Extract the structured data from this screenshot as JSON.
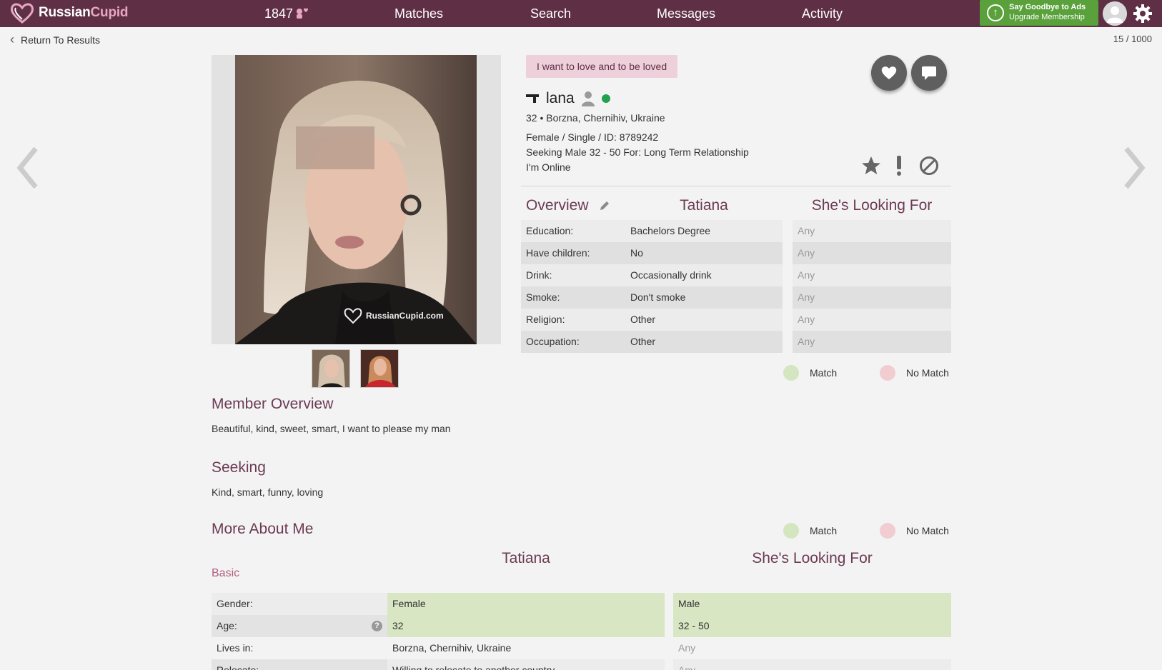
{
  "nav": {
    "logo_part1": "Russian",
    "logo_part2": "Cupid",
    "likes_count": "1847",
    "matches": "Matches",
    "search": "Search",
    "messages": "Messages",
    "activity": "Activity",
    "upgrade_line1": "Say Goodbye to Ads",
    "upgrade_line2": "Upgrade Membership"
  },
  "page": {
    "back_label": "Return To Results",
    "counter": "15 / 1000"
  },
  "profile": {
    "tagline": "I want to love and to be loved",
    "name": "lana",
    "location_line": "32 • Borzna, Chernihiv, Ukraine",
    "details_line": "Female / Single / ID: 8789242",
    "seeking_line": "Seeking Male 32 - 50 For: Long Term Relationship",
    "online_line": "I'm Online"
  },
  "overview": {
    "title": "Overview",
    "col_her": "Tatiana",
    "col_looking": "She's Looking For",
    "rows": [
      {
        "label": "Education:",
        "value": "Bachelors Degree",
        "looking": "Any"
      },
      {
        "label": "Have children:",
        "value": "No",
        "looking": "Any"
      },
      {
        "label": "Drink:",
        "value": "Occasionally drink",
        "looking": "Any"
      },
      {
        "label": "Smoke:",
        "value": "Don't smoke",
        "looking": "Any"
      },
      {
        "label": "Religion:",
        "value": "Other",
        "looking": "Any"
      },
      {
        "label": "Occupation:",
        "value": "Other",
        "looking": "Any"
      }
    ]
  },
  "legend": {
    "match": "Match",
    "no_match": "No Match"
  },
  "member_overview": {
    "title": "Member Overview",
    "text": "Beautiful, kind, sweet, smart, I want to please my man"
  },
  "seeking": {
    "title": "Seeking",
    "text": "Kind, smart, funny, loving"
  },
  "more_about": {
    "title": "More About Me",
    "col_her": "Tatiana",
    "col_looking": "She's Looking For",
    "basic": "Basic",
    "rows": [
      {
        "label": "Gender:",
        "value": "Female",
        "looking": "Male"
      },
      {
        "label": "Age:",
        "value": "32",
        "looking": "32 - 50"
      },
      {
        "label": "Lives in:",
        "value": "Borzna, Chernihiv, Ukraine",
        "looking": "Any"
      },
      {
        "label": "Relocate:",
        "value": "Willing to relocate to another country",
        "looking": "Any"
      }
    ]
  },
  "colors": {
    "nav_bg": "#5f2f45",
    "accent": "#6b3b52",
    "upgrade_green": "#5aa13c",
    "online_green": "#23a24d",
    "match_green": "#d3e6bf",
    "no_match_pink": "#f1cdd2"
  },
  "icons": [
    "heart-logo-icon",
    "hearts-icon",
    "upgrade-arrow-icon",
    "gear-icon",
    "chevron-left-icon",
    "heart-icon",
    "chat-icon",
    "person-icon",
    "star-icon",
    "exclamation-icon",
    "block-icon",
    "pencil-icon",
    "help-icon"
  ]
}
